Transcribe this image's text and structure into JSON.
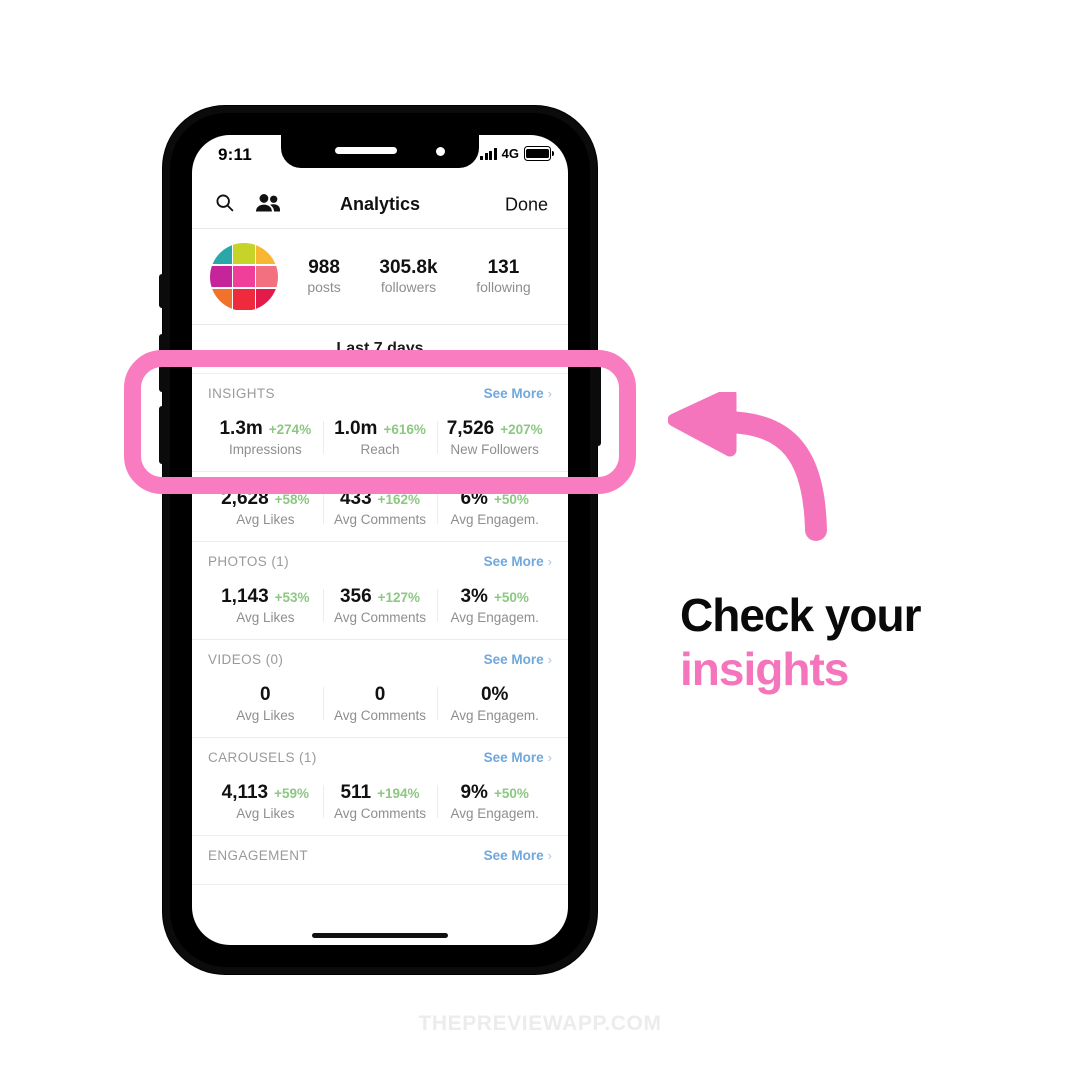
{
  "phone": {
    "status_bar": {
      "time": "9:11",
      "network": "4G",
      "signal_icon": "signal-bars-icon",
      "battery_icon": "battery-full-icon"
    },
    "nav_bar": {
      "search_icon": "search-icon",
      "people_icon": "people-icon",
      "title": "Analytics",
      "done_label": "Done"
    },
    "profile": {
      "avatar_name": "profile-avatar-grid",
      "avatar_colors": [
        "#2aa8a8",
        "#c6d429",
        "#f7b733",
        "#c6249b",
        "#ef3f9b",
        "#f2707f",
        "#f2722c",
        "#ee2a3c",
        "#e31b4a"
      ],
      "stats": [
        {
          "value": "988",
          "label": "posts"
        },
        {
          "value": "305.8k",
          "label": "followers"
        },
        {
          "value": "131",
          "label": "following"
        }
      ]
    },
    "period_label": "Last 7 days",
    "see_more_label": "See More",
    "chevron_glyph": "›",
    "sections": [
      {
        "id": "insights",
        "title": "INSIGHTS",
        "has_header": true,
        "metrics": [
          {
            "value": "1.3m",
            "delta": "+274%",
            "label": "Impressions"
          },
          {
            "value": "1.0m",
            "delta": "+616%",
            "label": "Reach"
          },
          {
            "value": "7,526",
            "delta": "+207%",
            "label": "New Followers"
          }
        ]
      },
      {
        "id": "overall-averages",
        "title": "",
        "has_header": false,
        "metrics": [
          {
            "value": "2,628",
            "delta": "+58%",
            "label": "Avg Likes"
          },
          {
            "value": "433",
            "delta": "+162%",
            "label": "Avg Comments"
          },
          {
            "value": "6%",
            "delta": "+50%",
            "label": "Avg Engagem."
          }
        ]
      },
      {
        "id": "photos",
        "title": "PHOTOS (1)",
        "has_header": true,
        "metrics": [
          {
            "value": "1,143",
            "delta": "+53%",
            "label": "Avg Likes"
          },
          {
            "value": "356",
            "delta": "+127%",
            "label": "Avg Comments"
          },
          {
            "value": "3%",
            "delta": "+50%",
            "label": "Avg Engagem."
          }
        ]
      },
      {
        "id": "videos",
        "title": "VIDEOS (0)",
        "has_header": true,
        "metrics": [
          {
            "value": "0",
            "delta": "",
            "label": "Avg Likes"
          },
          {
            "value": "0",
            "delta": "",
            "label": "Avg Comments"
          },
          {
            "value": "0%",
            "delta": "",
            "label": "Avg Engagem."
          }
        ]
      },
      {
        "id": "carousels",
        "title": "CAROUSELS (1)",
        "has_header": true,
        "metrics": [
          {
            "value": "4,113",
            "delta": "+59%",
            "label": "Avg Likes"
          },
          {
            "value": "511",
            "delta": "+194%",
            "label": "Avg Comments"
          },
          {
            "value": "9%",
            "delta": "+50%",
            "label": "Avg Engagem."
          }
        ]
      },
      {
        "id": "engagement",
        "title": "ENGAGEMENT",
        "has_header": true,
        "metrics": []
      }
    ]
  },
  "annotation": {
    "highlight_name": "insights-highlight-box",
    "highlight_color": "#f97cc0",
    "arrow_name": "curved-arrow-icon",
    "arrow_color": "#f575bd",
    "caption_line1": "Check your",
    "caption_line2": "insights",
    "caption_line1_color": "#0a0a0a",
    "caption_line2_color": "#f575bd"
  },
  "watermark": "THEPREVIEWAPP.COM"
}
